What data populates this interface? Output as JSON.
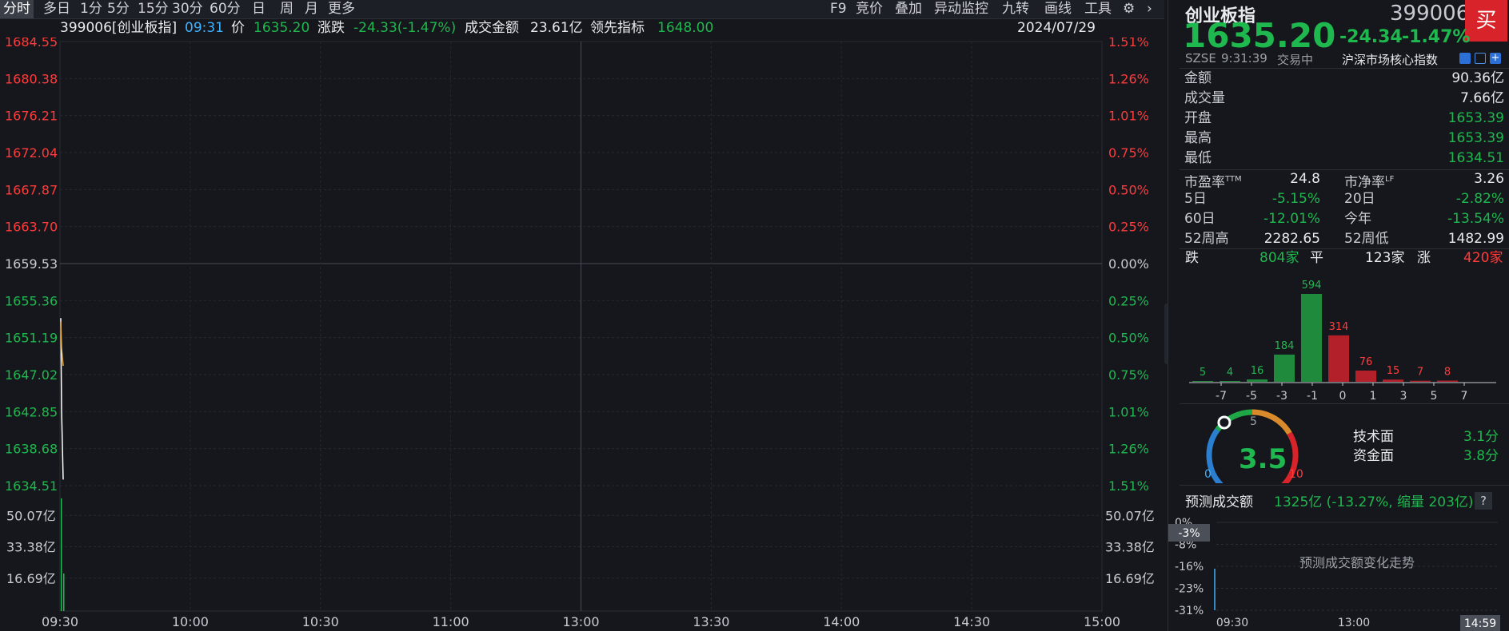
{
  "toolbar": {
    "tabs": [
      "分时",
      "多日",
      "1分",
      "5分",
      "15分",
      "30分",
      "60分",
      "日",
      "周",
      "月",
      "更多"
    ],
    "active_tab": "分时",
    "right_items": [
      "F9",
      "竞价",
      "叠加",
      "异动监控",
      "九转",
      "画线",
      "工具"
    ]
  },
  "info": {
    "code_name": "399006[创业板指]",
    "time": "09:31",
    "price_label": "价",
    "price": "1635.20",
    "change_label": "涨跌",
    "change": "-24.33(-1.47%)",
    "amount_label": "成交金额",
    "amount": "23.61亿",
    "lead_label": "领先指标",
    "lead": "1648.00",
    "date": "2024/07/29"
  },
  "chart": {
    "left_ticks": [
      "1684.55",
      "1680.38",
      "1676.21",
      "1672.04",
      "1667.87",
      "1663.70",
      "1659.53",
      "1655.36",
      "1651.19",
      "1647.02",
      "1642.85",
      "1638.68",
      "1634.51"
    ],
    "right_ticks": [
      "1.51%",
      "1.26%",
      "1.01%",
      "0.75%",
      "0.50%",
      "0.25%",
      "0.00%",
      "0.25%",
      "0.50%",
      "0.75%",
      "1.01%",
      "1.26%",
      "1.51%"
    ],
    "volume_ticks": [
      "50.07亿",
      "33.38亿",
      "16.69亿"
    ],
    "time_ticks": [
      "09:30",
      "10:00",
      "10:30",
      "11:00",
      "13:00",
      "13:30",
      "14:00",
      "14:30",
      "15:00"
    ]
  },
  "chart_data": {
    "type": "line",
    "ylim": [
      1634.51,
      1684.55
    ],
    "base": 1659.53,
    "x": [
      "09:30",
      "09:30",
      "09:31"
    ],
    "series": [
      {
        "values": [
          1653.39,
          1643.0,
          1635.2
        ]
      },
      {
        "values": [
          1653.0,
          1650.0,
          1648.0
        ]
      }
    ],
    "volume": {
      "ylim": [
        0,
        66.76
      ],
      "values": [
        60.0,
        20.0
      ]
    }
  },
  "quote": {
    "name": "创业板指",
    "code": "399006",
    "price": "1635.20",
    "change": "-24.34",
    "change_pct": "-1.47%",
    "buy_label": "买",
    "exchange": "SZSE",
    "time": "9:31:39",
    "status": "交易中",
    "category": "沪深市场核心指数",
    "rows": [
      {
        "label": "金额",
        "value": "90.36亿"
      },
      {
        "label": "成交量",
        "value": "7.66亿"
      },
      {
        "label": "开盘",
        "value": "1653.39"
      },
      {
        "label": "最高",
        "value": "1653.39"
      },
      {
        "label": "最低",
        "value": "1634.51"
      }
    ],
    "pair_rows": [
      {
        "l1": "市盈率",
        "l1sup": "TTM",
        "v1": "24.8",
        "l2": "市净率",
        "l2sup": "LF",
        "v2": "3.26"
      },
      {
        "l1": "5日",
        "v1": "-5.15%",
        "l2": "20日",
        "v2": "-2.82%"
      },
      {
        "l1": "60日",
        "v1": "-12.01%",
        "l2": "今年",
        "v2": "-13.54%"
      },
      {
        "l1": "52周高",
        "v1": "2282.65",
        "l2": "52周低",
        "v2": "1482.99"
      }
    ],
    "breadth": {
      "down_label": "跌",
      "down": "804家",
      "flat_label": "平",
      "flat": "123家",
      "up_label": "涨",
      "up": "420家"
    },
    "dist": {
      "labels": [
        "5",
        "4",
        "16",
        "184",
        "594",
        "314",
        "76",
        "15",
        "7",
        "8"
      ],
      "values": [
        5,
        4,
        16,
        184,
        594,
        314,
        76,
        15,
        7,
        8
      ],
      "axis": [
        "-7",
        "-5",
        "-3",
        "-1",
        "0",
        "1",
        "3",
        "5",
        "7"
      ]
    },
    "score": {
      "value": "3.5",
      "gauge_value": 3.5,
      "min": "0",
      "mid": "5",
      "max": "10",
      "tech_label": "技术面",
      "tech": "3.1分",
      "fund_label": "资金面",
      "fund": "3.8分"
    },
    "forecast": {
      "label": "预测成交额",
      "value": "1325亿 (-13.27%, 缩量 203亿)",
      "help": "?",
      "y_ticks": [
        "0%",
        "-8%",
        "-16%",
        "-23%",
        "-31%"
      ],
      "badge": "-3%",
      "title": "预测成交额变化走势",
      "x_ticks": [
        "09:30",
        "13:00"
      ],
      "end_time": "14:59"
    }
  }
}
